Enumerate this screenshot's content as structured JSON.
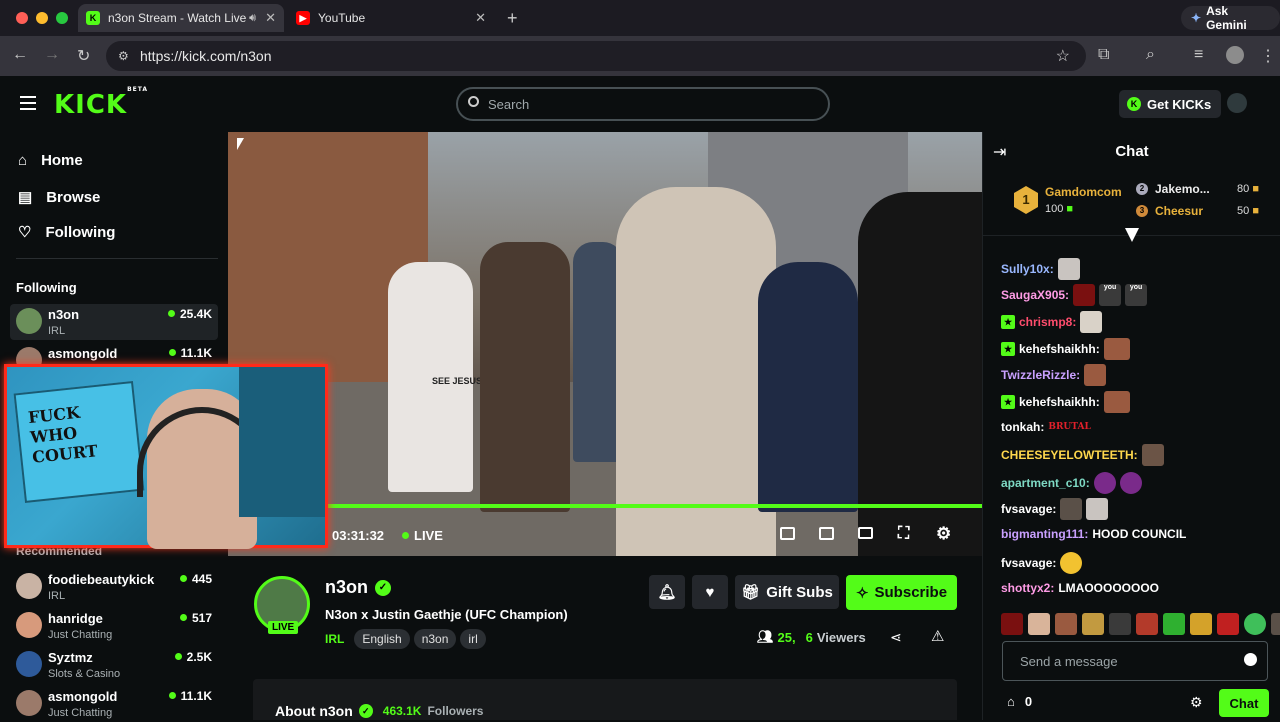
{
  "browser": {
    "tabs": [
      {
        "label": "n3on Stream - Watch Live",
        "active": true
      },
      {
        "label": "YouTube",
        "active": false
      }
    ],
    "url": "https://kick.com/n3on",
    "ask_gemini": "Ask Gemini"
  },
  "header": {
    "logo": "KICK",
    "logo_badge": "BETA",
    "search_placeholder": "Search",
    "get_kicks": "Get KICKs"
  },
  "sidebar": {
    "nav": [
      {
        "label": "Home",
        "icon": "home-icon"
      },
      {
        "label": "Browse",
        "icon": "browse-icon"
      },
      {
        "label": "Following",
        "icon": "heart-icon"
      }
    ],
    "following_heading": "Following",
    "following": [
      {
        "name": "n3on",
        "category": "IRL",
        "viewers": "25.4K"
      },
      {
        "name": "asmongold",
        "category": "",
        "viewers": "11.1K"
      }
    ],
    "recommended_heading": "Recommended",
    "recommended": [
      {
        "name": "foodiebeautykick",
        "category": "IRL",
        "viewers": "445"
      },
      {
        "name": "hanridge",
        "category": "Just Chatting",
        "viewers": "517"
      },
      {
        "name": "Syztmz",
        "category": "Slots & Casino",
        "viewers": "2.5K"
      },
      {
        "name": "asmongold",
        "category": "Just Chatting",
        "viewers": "11.1K"
      }
    ]
  },
  "video": {
    "time": "03:31:32",
    "live_label": "LIVE",
    "hoodie_text": "SEE JESUS",
    "webcam_sign": "FUCK WHO COURT"
  },
  "channel": {
    "name": "n3on",
    "live_badge": "LIVE",
    "title": "N3on x Justin Gaethje (UFC Champion)",
    "category": "IRL",
    "tags": [
      "English",
      "n3on",
      "irl"
    ],
    "gift_subs": "Gift Subs",
    "subscribe": "Subscribe",
    "viewers_count": "25,",
    "viewers_count_2": "6",
    "viewers_label": "Viewers",
    "about_title": "About n3on",
    "followers": "463.1K",
    "followers_label": "Followers"
  },
  "chat": {
    "title": "Chat",
    "leaderboard": [
      {
        "rank": "1",
        "name": "Gamdomcom",
        "value": "100"
      },
      {
        "rank": "2",
        "name": "Jakemo...",
        "value": "80"
      },
      {
        "rank": "3",
        "name": "Cheesur",
        "value": "50"
      }
    ],
    "messages": [
      {
        "user": "Sully10x:",
        "text": "",
        "color": "#9ab8ff"
      },
      {
        "user": "SaugaX905:",
        "text": "",
        "color": "#ff9ce6"
      },
      {
        "user": "chrismp8:",
        "text": "",
        "color": "#ff4d6d"
      },
      {
        "user": "kehefshaikhh:",
        "text": "",
        "color": "#ffffff"
      },
      {
        "user": "TwizzleRizzle:",
        "text": "",
        "color": "#c9a0ff"
      },
      {
        "user": "kehefshaikhh:",
        "text": "",
        "color": "#ffffff"
      },
      {
        "user": "tonkah:",
        "text": "",
        "color": "#ffffff"
      },
      {
        "user": "CHEESEYELOWTEETH:",
        "text": "",
        "color": "#ffd84d"
      },
      {
        "user": "apartment_c10:",
        "text": "",
        "color": "#7ed9c4"
      },
      {
        "user": "fvsavage:",
        "text": "",
        "color": "#ffffff"
      },
      {
        "user": "bigmanting111:",
        "text": "HOOD COUNCIL",
        "color": "#c9a0ff"
      },
      {
        "user": "fvsavage:",
        "text": "",
        "color": "#ffffff"
      },
      {
        "user": "shottyx2:",
        "text": "LMAOOOOOOOO",
        "color": "#ff9ce6"
      }
    ],
    "brutal_emote": "BRUTAL",
    "emote_you": "you",
    "input_placeholder": "Send a message",
    "points": "0",
    "send_label": "Chat"
  }
}
